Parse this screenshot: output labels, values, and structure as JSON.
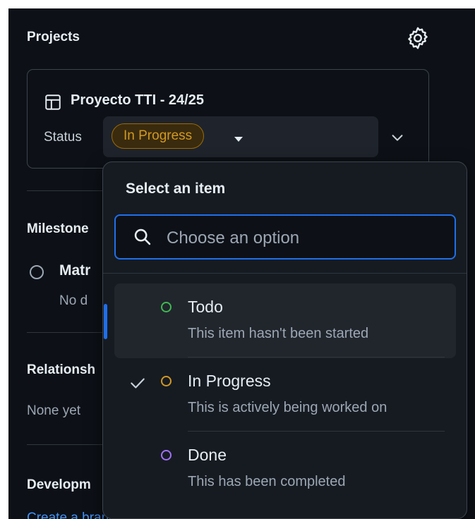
{
  "projects": {
    "title": "Projects",
    "project_name": "Proyecto TTI - 24/25",
    "status_label": "Status",
    "status_value": "In Progress"
  },
  "milestone": {
    "title": "Milestone",
    "name": "Matr",
    "due": "No d"
  },
  "relationships": {
    "title": "Relationsh",
    "value": "None yet"
  },
  "development": {
    "title": "Developm",
    "link_text": "Create a branch for this issue or link a pull request."
  },
  "dropdown": {
    "title": "Select an item",
    "search_placeholder": "Choose an option",
    "options": [
      {
        "label": "Todo",
        "description": "This item hasn't been started",
        "color": "#3fb950"
      },
      {
        "label": "In Progress",
        "description": "This is actively being worked on",
        "color": "#d29922",
        "selected": true
      },
      {
        "label": "Done",
        "description": "This has been completed",
        "color": "#a371f7"
      }
    ]
  },
  "colors": {
    "background": "#0d1117",
    "overlay": "#161b22",
    "accent_blue": "#1f6feb",
    "link": "#4493f8"
  }
}
